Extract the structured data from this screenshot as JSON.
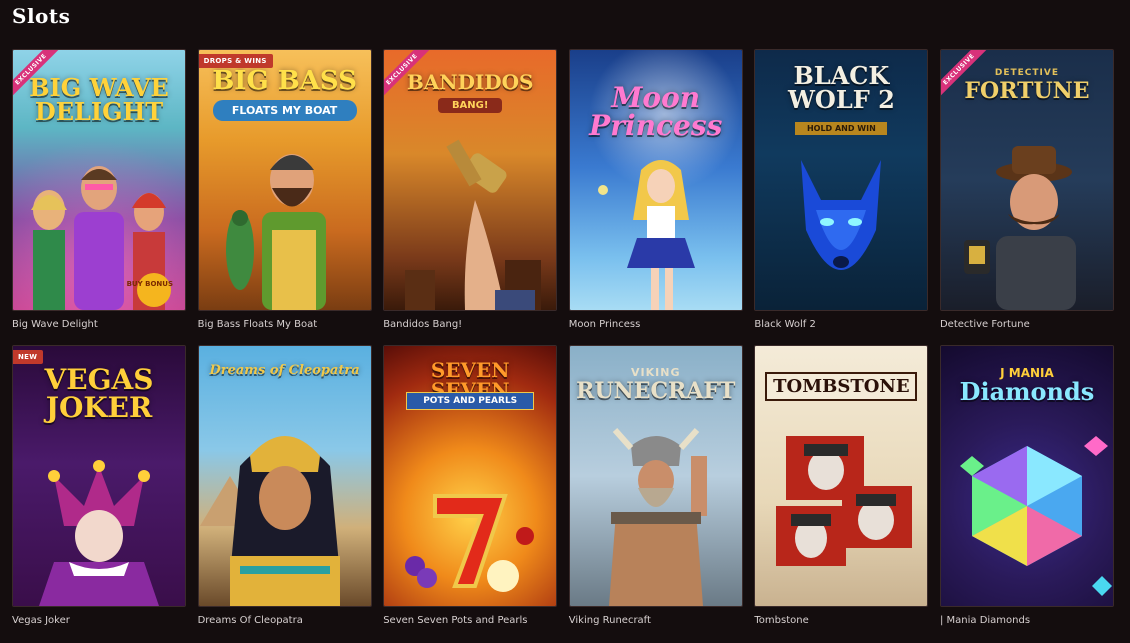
{
  "page": {
    "title": "Slots"
  },
  "games": [
    {
      "name": "Big Wave Delight",
      "logo": "BIG WAVE DELIGHT",
      "badge": "EXCLUSIVE",
      "sub": "BUY BONUS"
    },
    {
      "name": "Big Bass Floats My Boat",
      "logo": "BIG BASS",
      "badge": "DROPS & WINS",
      "sub": "FLOATS MY BOAT"
    },
    {
      "name": "Bandidos Bang!",
      "logo": "BANDIDOS",
      "badge": "EXCLUSIVE",
      "sub": "BANG!"
    },
    {
      "name": "Moon Princess",
      "logo": "Moon Princess",
      "badge": "",
      "sub": ""
    },
    {
      "name": "Black Wolf 2",
      "logo": "BLACK WOLF 2",
      "badge": "",
      "sub": "HOLD AND WIN"
    },
    {
      "name": "Detective Fortune",
      "logo": "FORTUNE",
      "badge": "EXCLUSIVE",
      "sub": "DETECTIVE"
    },
    {
      "name": "Vegas Joker",
      "logo": "VEGAS JOKER",
      "badge": "NEW",
      "sub": ""
    },
    {
      "name": "Dreams Of Cleopatra",
      "logo": "Dreams of Cleopatra",
      "badge": "",
      "sub": ""
    },
    {
      "name": "Seven Seven Pots and Pearls",
      "logo": "SEVEN SEVEN",
      "badge": "",
      "sub": "POTS AND PEARLS"
    },
    {
      "name": "Viking Runecraft",
      "logo": "RUNECRAFT",
      "badge": "",
      "sub": "VIKING"
    },
    {
      "name": "Tombstone",
      "logo": "TOMBSTONE",
      "badge": "",
      "sub": ""
    },
    {
      "name": "| Mania Diamonds",
      "logo": "Diamonds",
      "badge": "",
      "sub": "J MANIA"
    }
  ]
}
